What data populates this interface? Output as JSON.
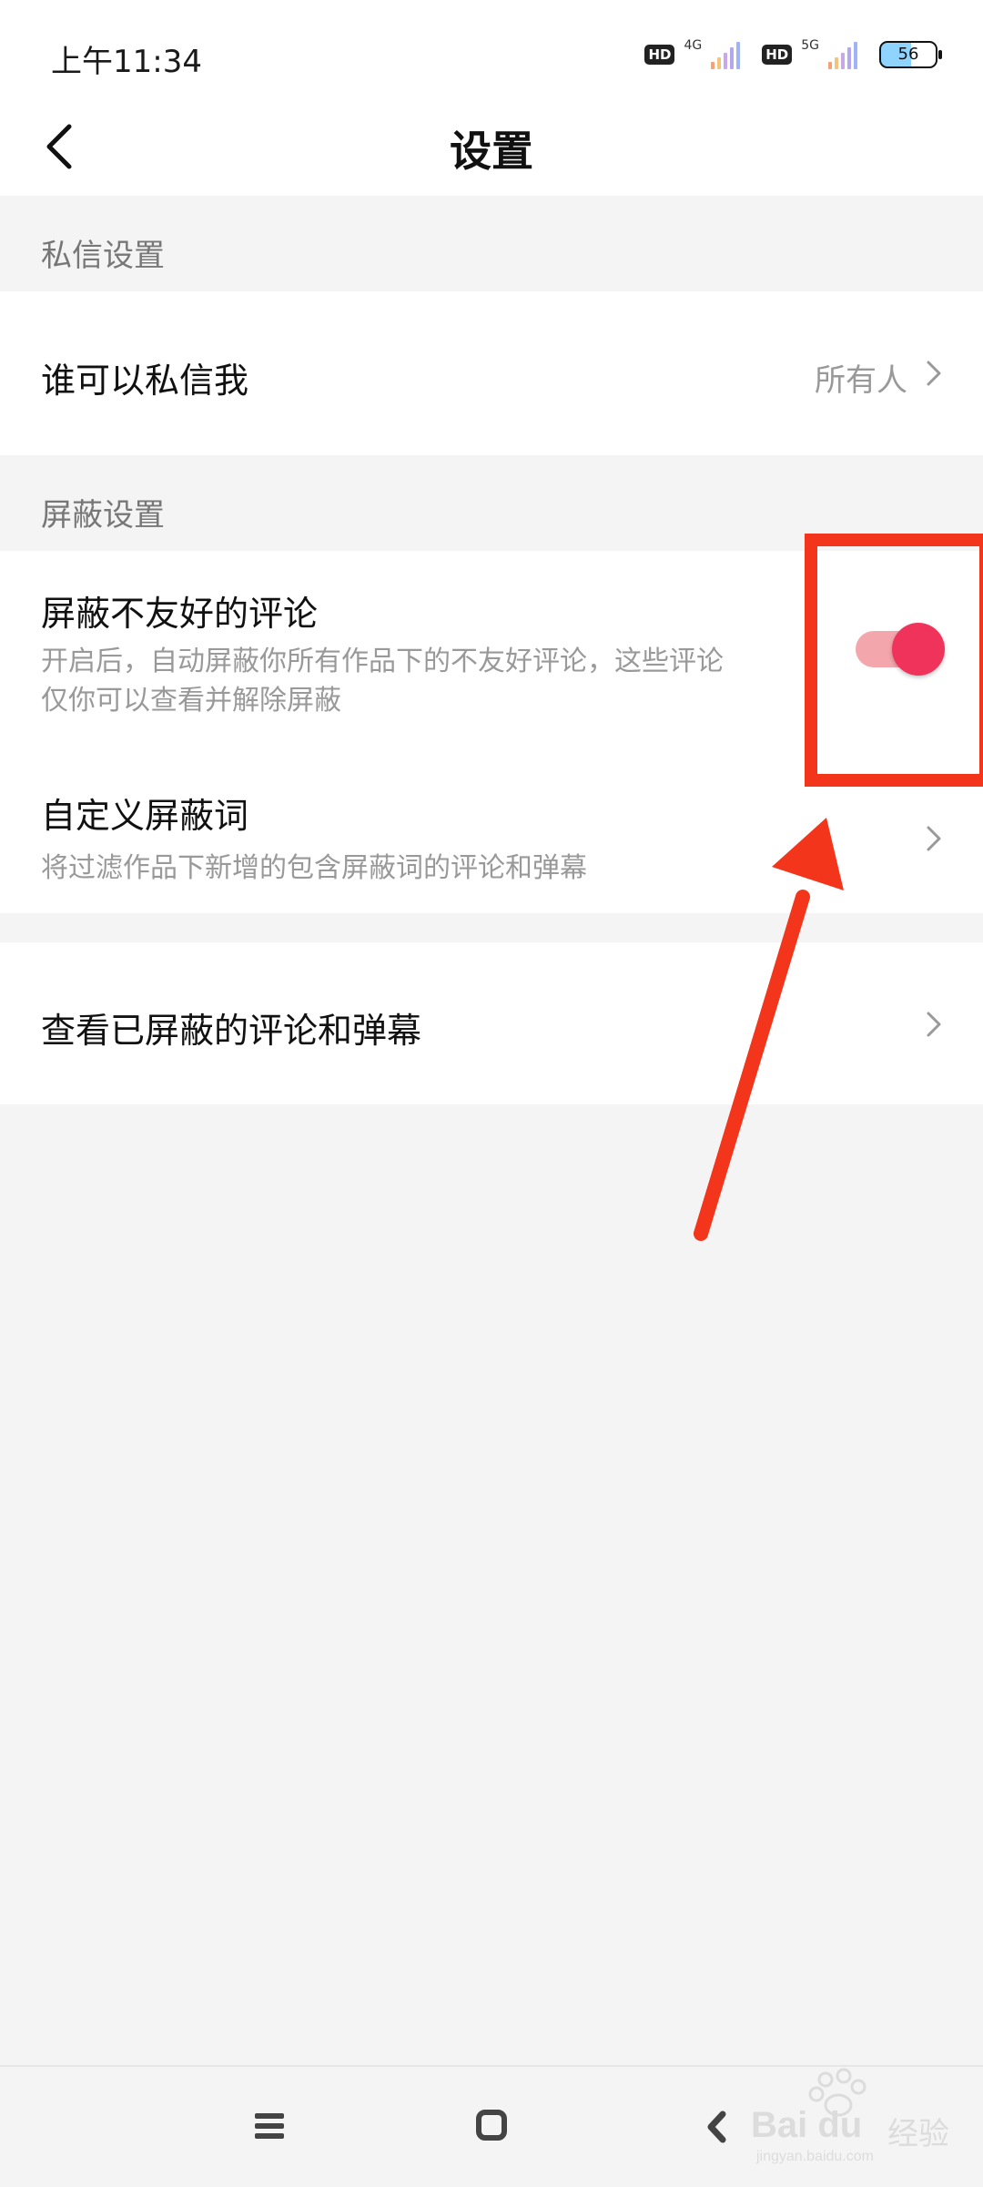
{
  "status_bar": {
    "time": "上午11:34",
    "sim1": {
      "badge": "HD",
      "network": "4G"
    },
    "sim2": {
      "badge": "HD",
      "network": "5G"
    },
    "battery": "56"
  },
  "nav": {
    "title": "设置",
    "back_icon": "chevron-left-icon"
  },
  "sections": {
    "private_message": {
      "header": "私信设置",
      "who_can_message": {
        "label": "谁可以私信我",
        "value": "所有人"
      }
    },
    "block": {
      "header": "屏蔽设置",
      "block_unfriendly": {
        "label": "屏蔽不友好的评论",
        "desc_line1": "开启后，自动屏蔽你所有作品下的不友好评论，这些评论",
        "desc_line2": "仅你可以查看并解除屏蔽",
        "toggle_on": true
      },
      "custom_words": {
        "label": "自定义屏蔽词",
        "desc": "将过滤作品下新增的包含屏蔽词的评论和弹幕"
      }
    },
    "view_blocked": {
      "label": "查看已屏蔽的评论和弹幕"
    }
  },
  "system_nav": {
    "menu_icon": "menu-icon",
    "home_icon": "home-icon",
    "back_icon": "back-icon"
  },
  "watermark": {
    "brand": "Bai du",
    "cn": "经验",
    "url": "jingyan.baidu.com"
  },
  "colors": {
    "accent": "#f0335b",
    "toggle_track": "#f4a6ad",
    "annotation": "#f3351c",
    "background": "#f4f4f5"
  }
}
